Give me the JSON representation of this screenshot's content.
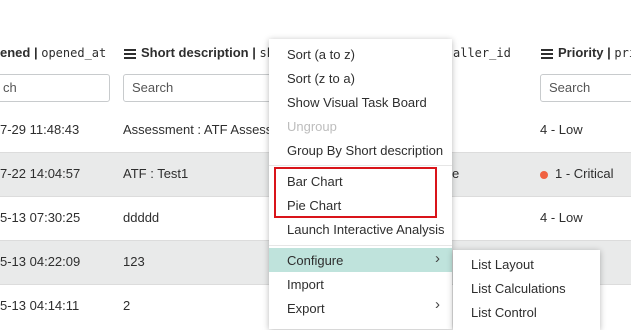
{
  "columns": [
    {
      "label": "ened",
      "field": "opened_at"
    },
    {
      "label": "Short description",
      "field": "shor"
    },
    {
      "label": "",
      "field": "aller_id"
    },
    {
      "label": "Priority",
      "field": "pric"
    }
  ],
  "search_placeholder": "Search",
  "search_partial": "ch",
  "rows": [
    {
      "opened": "7-29 11:48:43",
      "desc": "Assessment : ATF Assessor",
      "caller": "",
      "priority": "4 - Low",
      "critical": false
    },
    {
      "opened": "7-22 14:04:57",
      "desc": "ATF : Test1",
      "caller": "e",
      "priority": "1 - Critical",
      "critical": true
    },
    {
      "opened": "5-13 07:30:25",
      "desc": "ddddd",
      "caller": "",
      "priority": "4 - Low",
      "critical": false
    },
    {
      "opened": "5-13 04:22:09",
      "desc": "123",
      "caller": "",
      "priority": "",
      "critical": false
    },
    {
      "opened": "5-13 04:14:11",
      "desc": "2",
      "caller": "",
      "priority": "",
      "critical": false
    }
  ],
  "context_menu": {
    "items": [
      {
        "label": "Sort (a to z)",
        "disabled": false
      },
      {
        "label": "Sort (z to a)",
        "disabled": false
      },
      {
        "label": "Show Visual Task Board",
        "disabled": false
      },
      {
        "label": "Ungroup",
        "disabled": true
      },
      {
        "label": "Group By Short description",
        "disabled": false
      },
      {
        "label": "Bar Chart",
        "disabled": false
      },
      {
        "label": "Pie Chart",
        "disabled": false
      },
      {
        "label": "Launch Interactive Analysis",
        "disabled": false
      },
      {
        "label": "Configure",
        "disabled": false
      },
      {
        "label": "Import",
        "disabled": false
      },
      {
        "label": "Export",
        "disabled": false
      }
    ],
    "highlighted": "Configure",
    "highlight_color": "#bfe3dc",
    "annotation_color": "#d9141a"
  },
  "submenu": {
    "items": [
      {
        "label": "List Layout"
      },
      {
        "label": "List Calculations"
      },
      {
        "label": "List Control"
      }
    ]
  },
  "colors": {
    "critical_dot": "#f06141",
    "alt_row": "#e9eaea"
  }
}
